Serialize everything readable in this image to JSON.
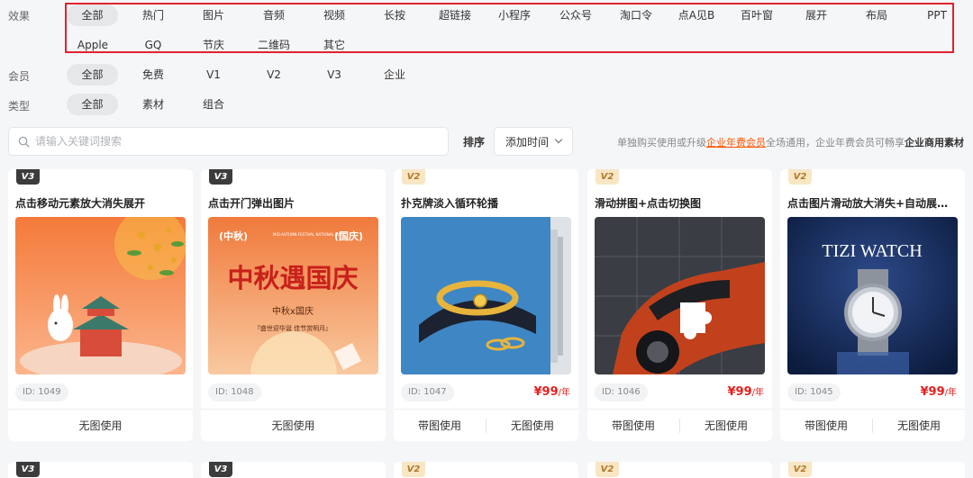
{
  "filters": {
    "effect": {
      "label": "效果",
      "row1": [
        "全部",
        "热门",
        "图片",
        "音频",
        "视频",
        "长按",
        "超链接",
        "小程序",
        "公众号",
        "淘口令",
        "点A见B",
        "百叶窗",
        "展开",
        "布局",
        "PPT"
      ],
      "row2": [
        "Apple",
        "GQ",
        "节庆",
        "二维码",
        "其它"
      ]
    },
    "member": {
      "label": "会员",
      "items": [
        "全部",
        "免费",
        "V1",
        "V2",
        "V3",
        "企业"
      ]
    },
    "type": {
      "label": "类型",
      "items": [
        "全部",
        "素材",
        "组合"
      ]
    }
  },
  "search": {
    "placeholder": "请输入关键词搜索"
  },
  "sort": {
    "label": "排序",
    "value": "添加时间"
  },
  "notice": {
    "prefix": "单独购买使用或升级",
    "link": "企业年费会员",
    "middle": "全场通用，企业年费会员可畅享",
    "bold": "企业商用素材"
  },
  "cards": [
    {
      "badge": "V3",
      "title": "点击移动元素放大消失展开",
      "id": "ID: 1049",
      "price": "",
      "unit": "",
      "buttons": [
        "无图使用"
      ]
    },
    {
      "badge": "V3",
      "title": "点击开门弹出图片",
      "id": "ID: 1048",
      "price": "",
      "unit": "",
      "buttons": [
        "无图使用"
      ]
    },
    {
      "badge": "V2",
      "title": "扑克牌淡入循环轮播",
      "id": "ID: 1047",
      "price": "¥99",
      "unit": "/年",
      "buttons": [
        "带图使用",
        "无图使用"
      ]
    },
    {
      "badge": "V2",
      "title": "滑动拼图+点击切换图",
      "id": "ID: 1046",
      "price": "¥99",
      "unit": "/年",
      "buttons": [
        "带图使用",
        "无图使用"
      ]
    },
    {
      "badge": "V2",
      "title": "点击图片滑动放大消失+自动展开[...",
      "id": "ID: 1045",
      "price": "¥99",
      "unit": "/年",
      "buttons": [
        "带图使用",
        "无图使用"
      ]
    }
  ],
  "thumb_text": {
    "c2_tag_left": "(中秋)",
    "c2_tag_right": "(国庆)",
    "c2_small": "MID-AUTUMN FESTIVAL NATIONAL DAY",
    "c2_big": "中秋遇国庆",
    "c2_sub": "中秋x国庆",
    "c2_line": "『盛世迎华诞  佳节赏明月』",
    "c5_brand": "TIZI WATCH"
  },
  "peek_badges": [
    "V3",
    "V3",
    "V2",
    "V2",
    "V2"
  ],
  "colors": {
    "accent": "#ff5500",
    "price": "#e4201d",
    "highlight_box": "#e0232e"
  }
}
